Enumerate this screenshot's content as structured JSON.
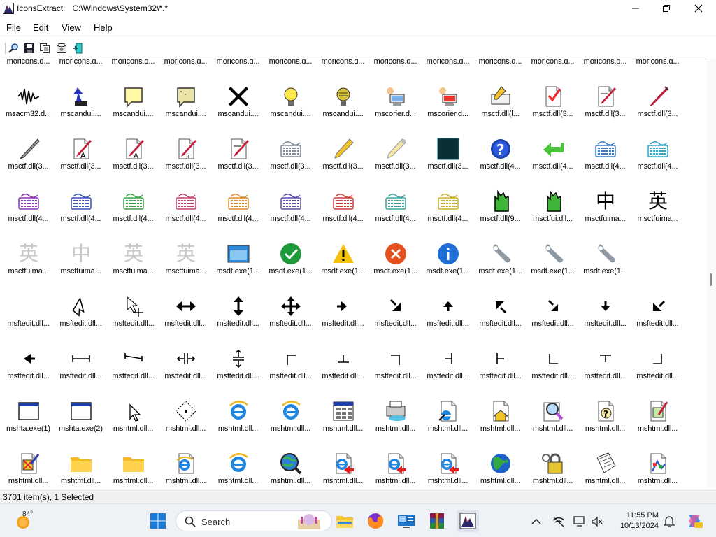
{
  "window": {
    "title": "IconsExtract:   C:\\Windows\\System32\\*.*"
  },
  "menu": [
    "File",
    "Edit",
    "View",
    "Help"
  ],
  "status": {
    "text": "3701 item(s), 1 Selected"
  },
  "taskbar": {
    "temperature": "84°",
    "search_placeholder": "Search",
    "time": "11:55 PM",
    "date": "10/13/2024"
  },
  "grid": {
    "columns": 13,
    "rows": [
      {
        "label": "moricons.d...",
        "icons": [
          "doc",
          "doc",
          "doc",
          "doc",
          "doc",
          "doc",
          "doc",
          "doc",
          "doc",
          "doc",
          "doc",
          "doc",
          "doc"
        ],
        "labels": [
          "moricons.d...",
          "moricons.d...",
          "moricons.d...",
          "moricons.d...",
          "moricons.d...",
          "moricons.d...",
          "moricons.d...",
          "moricons.d...",
          "moricons.d...",
          "moricons.d...",
          "moricons.d...",
          "moricons.d...",
          "moricons.d..."
        ]
      },
      {
        "icons": [
          "wave",
          "cand-blue",
          "note-yellow",
          "note-tan",
          "x-black",
          "bulb-yellow",
          "bulb-dark",
          "computer-user",
          "computer-user2",
          "keyboard-pen",
          "check-doc",
          "doc-pen",
          "pen-red"
        ],
        "labels": [
          "msacm32.d...",
          "mscandui....",
          "mscandui....",
          "mscandui....",
          "mscandui....",
          "mscandui....",
          "mscandui....",
          "mscorier.d...",
          "mscorier.d...",
          "msctf.dll(l...",
          "msctf.dll(3...",
          "msctf.dll(3...",
          "msctf.dll(3..."
        ]
      },
      {
        "icons": [
          "pen-gray",
          "doc-pen-a",
          "doc-pen-a2",
          "doc-pen-jr",
          "doc-pen",
          "keyboard-gray",
          "pencil-yellow",
          "pencil-gray",
          "square-dark",
          "help-blue",
          "arrow-green",
          "keyboard-blue",
          "keyboard-cyan"
        ],
        "labels": [
          "msctf.dll(3...",
          "msctf.dll(3...",
          "msctf.dll(3...",
          "msctf.dll(3...",
          "msctf.dll(3...",
          "msctf.dll(3...",
          "msctf.dll(3...",
          "msctf.dll(3...",
          "msctf.dll(3...",
          "msctf.dll(4...",
          "msctf.dll(4...",
          "msctf.dll(4...",
          "msctf.dll(4..."
        ]
      },
      {
        "icons": [
          "kb-purple",
          "kb-blue",
          "kb-green",
          "kb-pink",
          "kb-orange",
          "kb-violet",
          "kb-red",
          "kb-teal",
          "kb-yellow",
          "hand-green",
          "hand-green",
          "cjk-zhong",
          "cjk-ying"
        ],
        "labels": [
          "msctf.dll(4...",
          "msctf.dll(4...",
          "msctf.dll(4...",
          "msctf.dll(4...",
          "msctf.dll(4...",
          "msctf.dll(4...",
          "msctf.dll(4...",
          "msctf.dll(4...",
          "msctf.dll(4...",
          "msctf.dll(9...",
          "msctfui.dll...",
          "msctfuima...",
          "msctfuima..."
        ]
      },
      {
        "icons": [
          "cjk-ying-gray",
          "cjk-zhong-gray",
          "cjk-ying-gray",
          "cjk-ying-gray",
          "window-blue",
          "check-green",
          "warn-yellow",
          "error-red",
          "info-blue",
          "wrench",
          "wrench",
          "wrench",
          ""
        ],
        "labels": [
          "msctfuima...",
          "msctfuima...",
          "msctfuima...",
          "msctfuima...",
          "msdt.exe(1...",
          "msdt.exe(1...",
          "msdt.exe(1...",
          "msdt.exe(1...",
          "msdt.exe(1...",
          "msdt.exe(1...",
          "msdt.exe(1...",
          "msdt.exe(1...",
          ""
        ]
      },
      {
        "icons": [
          "",
          "cursor-arrow",
          "cursor-move",
          "arrow-lr",
          "arrow-ud",
          "arrow-4",
          "arrow-r",
          "arrow-se",
          "arrow-u",
          "arrow-nw",
          "arrow-se2",
          "arrow-d",
          "arrow-sw"
        ],
        "labels": [
          "msftedit.dll...",
          "msftedit.dll...",
          "msftedit.dll...",
          "msftedit.dll...",
          "msftedit.dll...",
          "msftedit.dll...",
          "msftedit.dll...",
          "msftedit.dll...",
          "msftedit.dll...",
          "msftedit.dll...",
          "msftedit.dll...",
          "msftedit.dll...",
          "msftedit.dll..."
        ]
      },
      {
        "icons": [
          "arrow-l",
          "hbar",
          "hbar-tilt",
          "split-v",
          "split-h",
          "corner-tl",
          "tee-up",
          "corner-tr",
          "tee-left",
          "tee-right",
          "corner-bl",
          "tee-down",
          "corner-br"
        ],
        "labels": [
          "msftedit.dll...",
          "msftedit.dll...",
          "msftedit.dll...",
          "msftedit.dll...",
          "msftedit.dll...",
          "msftedit.dll...",
          "msftedit.dll...",
          "msftedit.dll...",
          "msftedit.dll...",
          "msftedit.dll...",
          "msftedit.dll...",
          "msftedit.dll...",
          "msftedit.dll..."
        ]
      },
      {
        "icons": [
          "win-small",
          "win-small",
          "cursor-outline",
          "diamond-dots",
          "ie-logo",
          "ie-logo",
          "window-grid",
          "printer",
          "ie-doc",
          "doc-house",
          "magnifier-doc",
          "doc-help",
          "doc-check"
        ],
        "labels": [
          "mshta.exe(1)",
          "mshta.exe(2)",
          "mshtml.dll...",
          "mshtml.dll...",
          "mshtml.dll...",
          "mshtml.dll...",
          "mshtml.dll...",
          "mshtml.dll...",
          "mshtml.dll...",
          "mshtml.dll...",
          "mshtml.dll...",
          "mshtml.dll...",
          "mshtml.dll..."
        ]
      },
      {
        "icons": [
          "doc-pen-x",
          "folder",
          "folder",
          "ie-page",
          "ie-logo",
          "globe-mag",
          "ie-red",
          "ie-red",
          "ie-red",
          "globe",
          "lock-keys",
          "newspaper",
          "doc-colors"
        ],
        "labels": [
          "mshtml.dll...",
          "mshtml.dll...",
          "mshtml.dll...",
          "mshtml.dll...",
          "mshtml.dll...",
          "mshtml.dll...",
          "mshtml.dll...",
          "mshtml.dll...",
          "mshtml.dll...",
          "mshtml.dll...",
          "mshtml.dll...",
          "mshtml.dll...",
          "mshtml.dll..."
        ]
      }
    ]
  },
  "colors": {
    "accent": "#0067c0",
    "statusbar": "#f0f0f0",
    "taskbar": "#eef2f7"
  }
}
